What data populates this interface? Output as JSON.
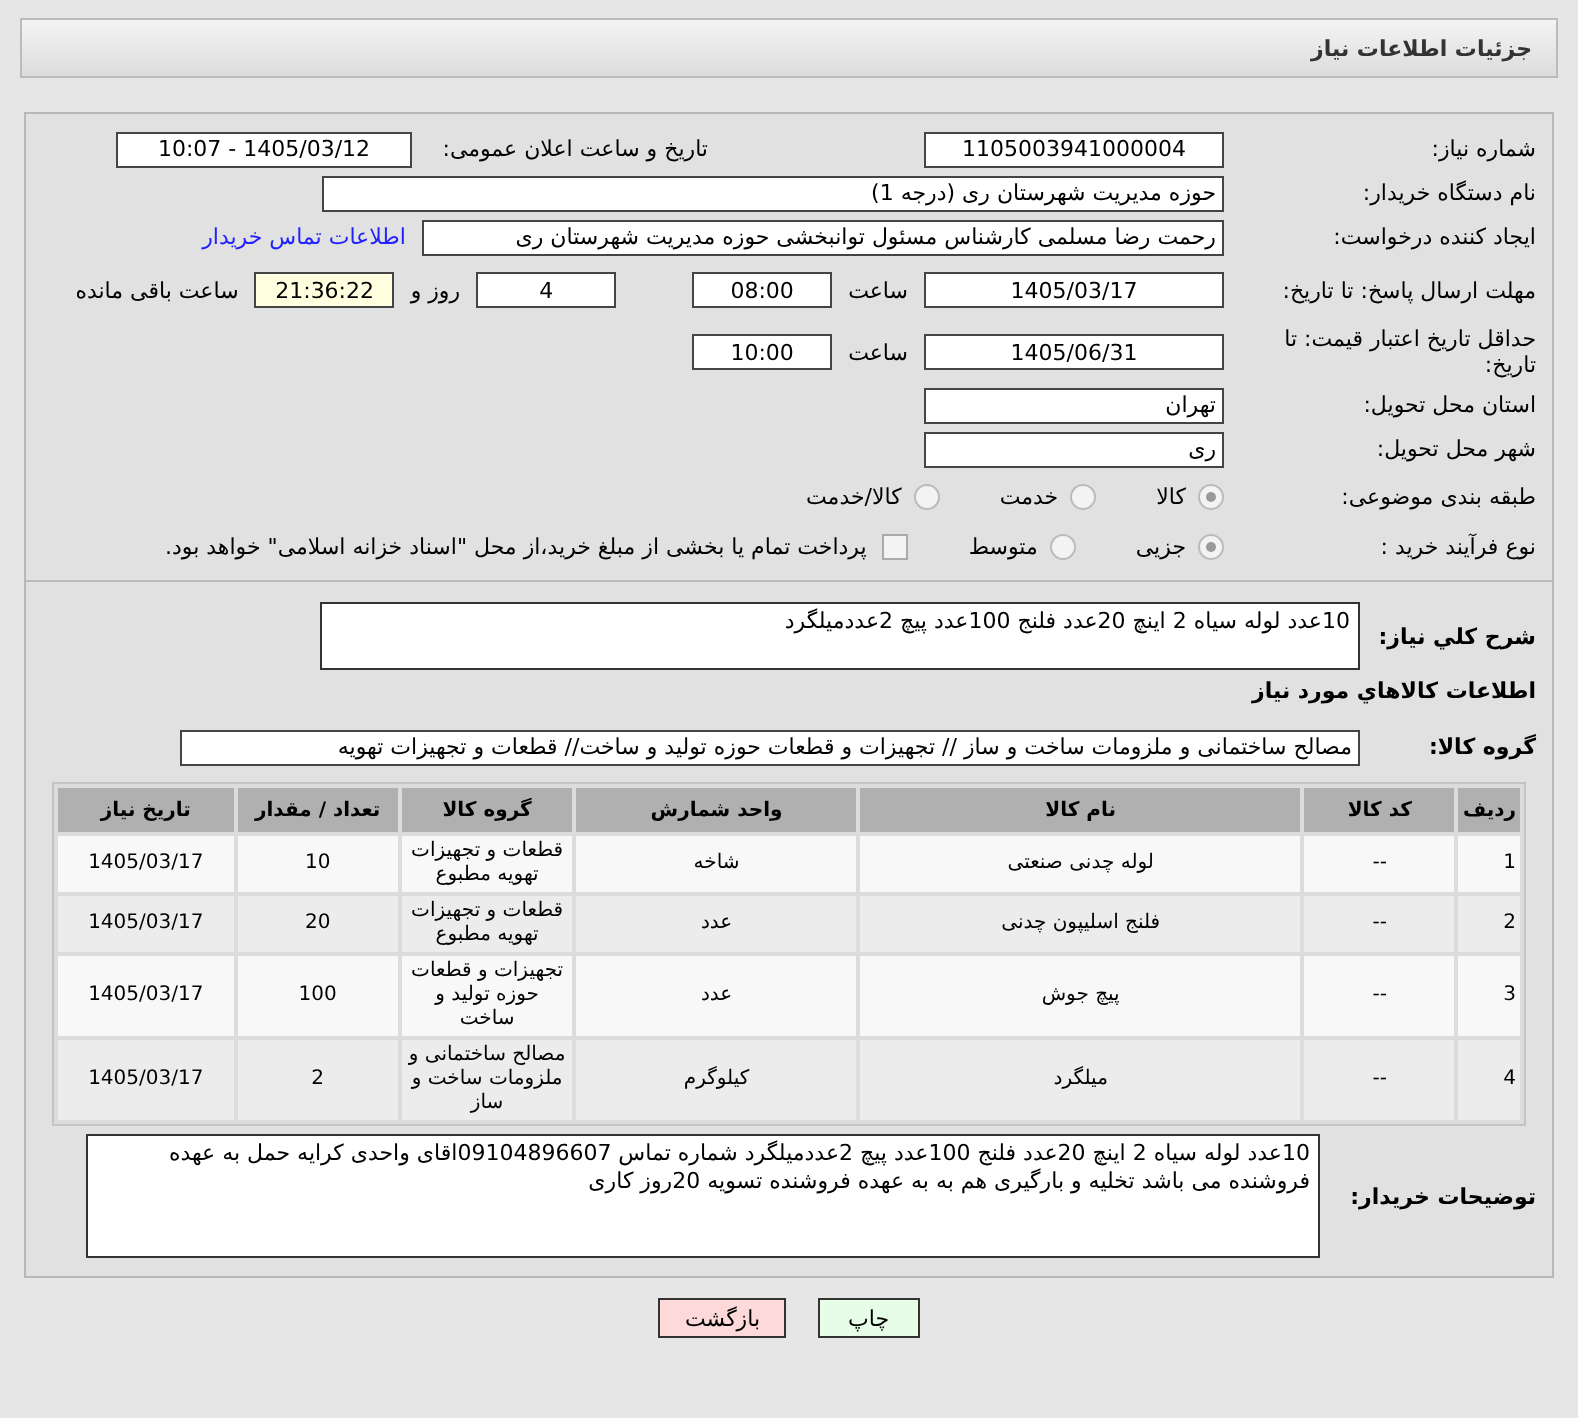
{
  "header": {
    "title": "جزئیات اطلاعات نیاز"
  },
  "need_number": {
    "label": "شماره نیاز:",
    "value": "1105003941000004"
  },
  "announce": {
    "label": "تاریخ و ساعت اعلان عمومی:",
    "value": "1405/03/12 - 10:07"
  },
  "buyer_org": {
    "label": "نام دستگاه خریدار:",
    "value": "حوزه مدیریت   شهرستان ری (درجه 1)"
  },
  "creator": {
    "label": "ایجاد کننده درخواست:",
    "value": "رحمت رضا مسلمی کارشناس مسئول توانبخشی حوزه مدیریت   شهرستان ری",
    "link": "اطلاعات تماس خریدار"
  },
  "deadline": {
    "label": "مهلت ارسال پاسخ: تا تاریخ:",
    "date": "1405/03/17",
    "time_label": "ساعت",
    "time": "08:00",
    "days": "4",
    "days_label": "روز و",
    "remaining": "21:36:22",
    "remaining_label": "ساعت باقی مانده"
  },
  "validity": {
    "label": "حداقل تاریخ اعتبار قیمت: تا تاریخ:",
    "date": "1405/06/31",
    "time_label": "ساعت",
    "time": "10:00"
  },
  "province": {
    "label": "استان محل تحویل:",
    "value": "تهران"
  },
  "city": {
    "label": "شهر محل تحویل:",
    "value": "ری"
  },
  "category": {
    "label": "طبقه بندی موضوعی:",
    "options": [
      {
        "label": "کالا",
        "selected": true
      },
      {
        "label": "خدمت",
        "selected": false
      },
      {
        "label": "کالا/خدمت",
        "selected": false
      }
    ]
  },
  "process": {
    "label": "نوع فرآیند خرید :",
    "options": [
      {
        "label": "جزیی",
        "selected": true
      },
      {
        "label": "متوسط",
        "selected": false
      }
    ],
    "payment": {
      "checked": false,
      "label": "پرداخت تمام یا بخشی از مبلغ خرید،از محل \"اسناد خزانه اسلامی\" خواهد بود."
    }
  },
  "description": {
    "label": "شرح كلي نياز:",
    "value": "10عدد لوله سیاه 2 اینچ 20عدد فلنج 100عدد پیچ 2عددمیلگرد"
  },
  "goods_title": "اطلاعات كالاهاي مورد نياز",
  "goods_group": {
    "label": "گروه کالا:",
    "value": "مصالح ساختمانی و ملزومات ساخت و ساز // تجهیزات و قطعات حوزه تولید و ساخت//  قطعات و تجهیزات تهویه"
  },
  "table": {
    "columns": [
      "ردیف",
      "کد کالا",
      "نام کالا",
      "واحد شمارش",
      "گروه کالا",
      "تعداد / مقدار",
      "تاریخ نیاز"
    ],
    "rows": [
      [
        "1",
        "--",
        "لوله چدنی صنعتی",
        "شاخه",
        "قطعات و تجهیزات تهویه مطبوع",
        "10",
        "1405/03/17"
      ],
      [
        "2",
        "--",
        "فلنج اسلیپون چدنی",
        "عدد",
        "قطعات و تجهیزات تهویه مطبوع",
        "20",
        "1405/03/17"
      ],
      [
        "3",
        "--",
        "پیچ جوش",
        "عدد",
        "تجهیزات و قطعات حوزه تولید و ساخت",
        "100",
        "1405/03/17"
      ],
      [
        "4",
        "--",
        "میلگرد",
        "کیلوگرم",
        "مصالح ساختمانی و ملزومات ساخت و ساز",
        "2",
        "1405/03/17"
      ]
    ]
  },
  "notes": {
    "label": "توضیحات خریدار:",
    "value": "10عدد لوله سیاه 2 اینچ 20عدد فلنج 100عدد پیچ 2عددمیلگرد شماره تماس 09104896607اقای واحدی کرایه حمل به عهده فروشنده می باشد تخلیه و بارگیری هم به به عهده فروشنده تسویه 20روز کاری"
  },
  "buttons": [
    {
      "kind": "print",
      "label": "چاپ"
    },
    {
      "kind": "back",
      "label": "بازگشت"
    }
  ]
}
